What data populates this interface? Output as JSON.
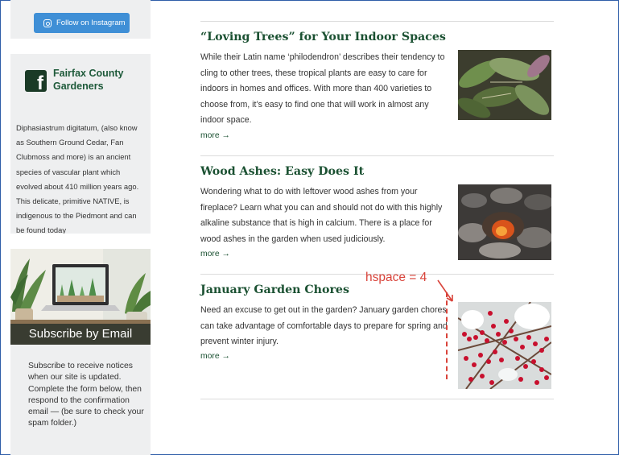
{
  "sidebar": {
    "instagram_label": "Follow on Instagram",
    "facebook_title": "Fairfax County Gardeners",
    "facebook_logo": "f",
    "excerpt": "Diphasiastrum digitatum, (also know as Southern Ground Cedar, Fan Clubmoss and more) is an ancient species of vascular plant which evolved about 410 million years ago. This delicate, primitive NATIVE, is indigenous to the Piedmont and can be found today",
    "subscribe_banner": "Subscribe by Email",
    "subscribe_text": "Subscribe to receive notices when our site is updated. Complete the form below, then respond to the confirmation email — (be sure to check your spam folder.)"
  },
  "articles": [
    {
      "title": "“Loving Trees” for Your Indoor Spaces",
      "body": "While their Latin name ‘philodendron’ describes their tendency to cling to other trees, these tropical plants are easy to care for indoors in homes and offices. With more than 400 varieties to choose from, it’s easy to find one that will work in almost any indoor space.",
      "more": "more →"
    },
    {
      "title": "Wood Ashes: Easy Does It",
      "body": "Wondering what to do with leftover wood ashes from your fireplace? Learn what you can and should not do with this highly alkaline substance that is high in calcium. There is a place for wood ashes in the garden when used judiciously.",
      "more": "more →"
    },
    {
      "title": "January Garden Chores",
      "body": "Need an excuse to get out in the garden? January garden chores can take advantage of comfortable days to prepare for spring and prevent winter injury.",
      "more": "more →"
    }
  ],
  "annotation": {
    "label": "hspace = 4",
    "color": "#d9433a"
  },
  "colors": {
    "heading_green": "#1b5132",
    "button_blue": "#3f8fd6",
    "sidebar_bg": "#eeeff0"
  }
}
